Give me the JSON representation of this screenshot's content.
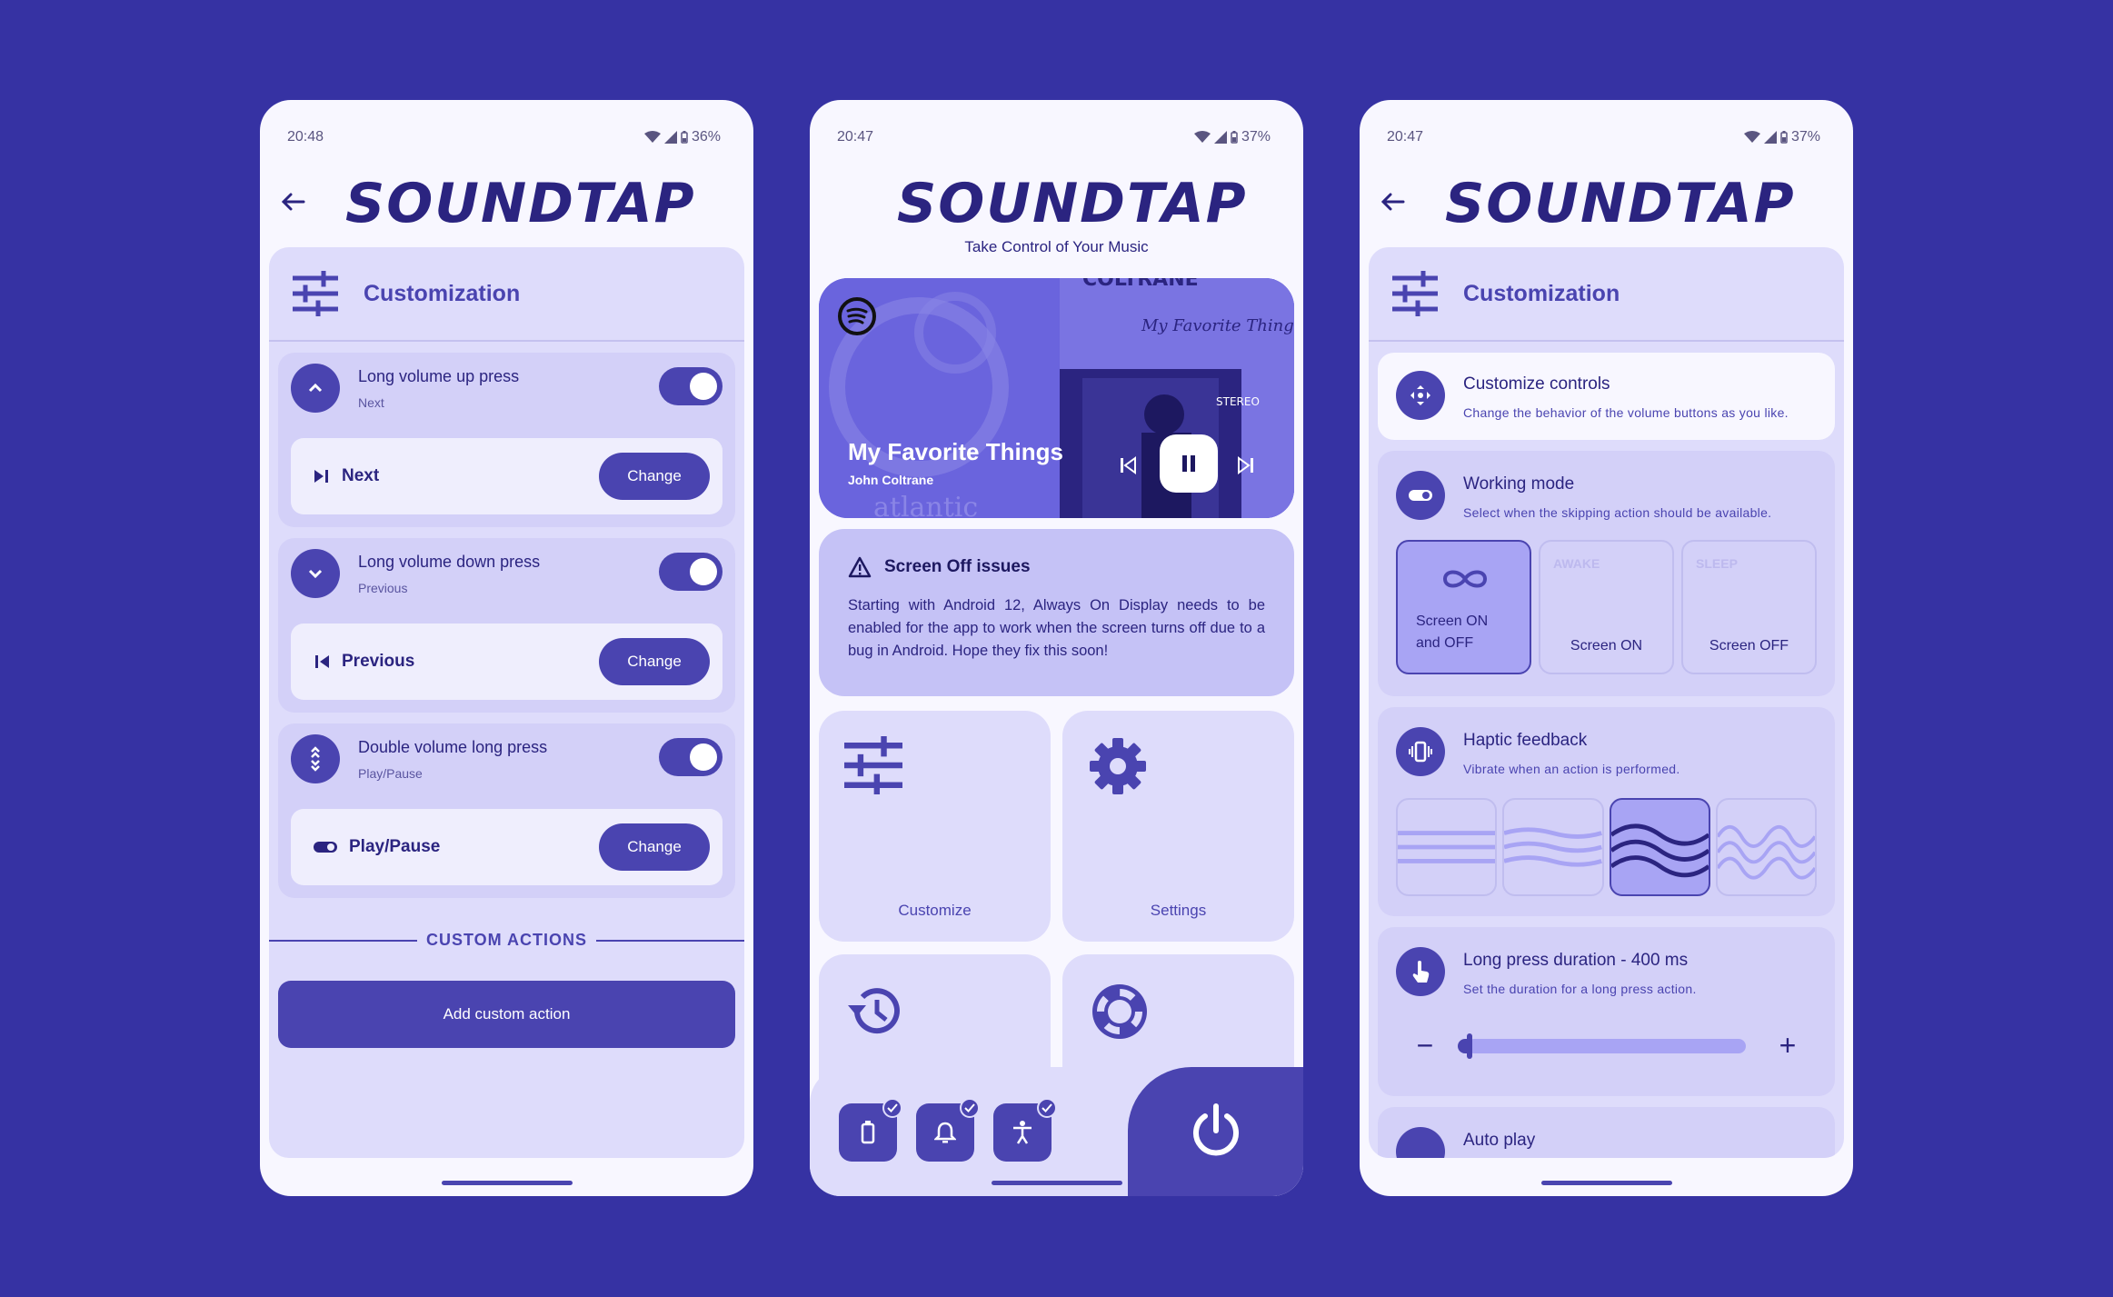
{
  "app": {
    "logo_text": "SOUNDTAP"
  },
  "phone1": {
    "status": {
      "time": "20:48",
      "battery": "36%"
    },
    "panel_title": "Customization",
    "groups": [
      {
        "title": "Long volume up press",
        "subtitle": "Next",
        "action_label": "Next",
        "change_label": "Change",
        "icon": "chevron-up-icon"
      },
      {
        "title": "Long volume down press",
        "subtitle": "Previous",
        "action_label": "Previous",
        "change_label": "Change",
        "icon": "chevron-down-icon"
      },
      {
        "title": "Double volume long press",
        "subtitle": "Play/Pause",
        "action_label": "Play/Pause",
        "change_label": "Change",
        "icon": "double-chevron-icon"
      }
    ],
    "custom_actions_label": "CUSTOM ACTIONS",
    "add_button_label": "Add custom action"
  },
  "phone2": {
    "status": {
      "time": "20:47",
      "battery": "37%"
    },
    "tagline": "Take Control of Your Music",
    "media": {
      "title": "My Favorite Things",
      "artist": "John Coltrane",
      "album_text": "My Favorite Things",
      "stereo": "STEREO",
      "album_top": "COLTRANE",
      "album_bottom": "atlantic"
    },
    "warning": {
      "title": "Screen Off issues",
      "text": "Starting with Android 12, Always On Display needs to be enabled for the app to work when the screen turns off due to a bug in Android. Hope they fix this soon!"
    },
    "tiles": [
      {
        "label": "Customize"
      },
      {
        "label": "Settings"
      },
      {
        "label": ""
      },
      {
        "label": ""
      }
    ]
  },
  "phone3": {
    "status": {
      "time": "20:47",
      "battery": "37%"
    },
    "panel_title": "Customization",
    "customize_controls": {
      "title": "Customize controls",
      "subtitle": "Change the behavior of the volume buttons as you like."
    },
    "working_mode": {
      "title": "Working mode",
      "subtitle": "Select when the skipping action should be available.",
      "modes": [
        {
          "top": "",
          "label": "Screen ON and OFF",
          "selected": true
        },
        {
          "top": "AWAKE",
          "label": "Screen ON",
          "selected": false
        },
        {
          "top": "SLEEP",
          "label": "Screen OFF",
          "selected": false
        }
      ]
    },
    "haptic": {
      "title": "Haptic feedback",
      "subtitle": "Vibrate when an action is performed.",
      "selected_index": 2
    },
    "long_press": {
      "title": "Long press duration - 400 ms",
      "subtitle": "Set the duration for a long press action.",
      "minus": "−",
      "plus": "+",
      "value_ms": 400
    },
    "auto_play": {
      "title": "Auto play"
    }
  },
  "colors": {
    "background": "#3632a3",
    "accent": "#4a44b0",
    "surface": "#dedcfb"
  }
}
